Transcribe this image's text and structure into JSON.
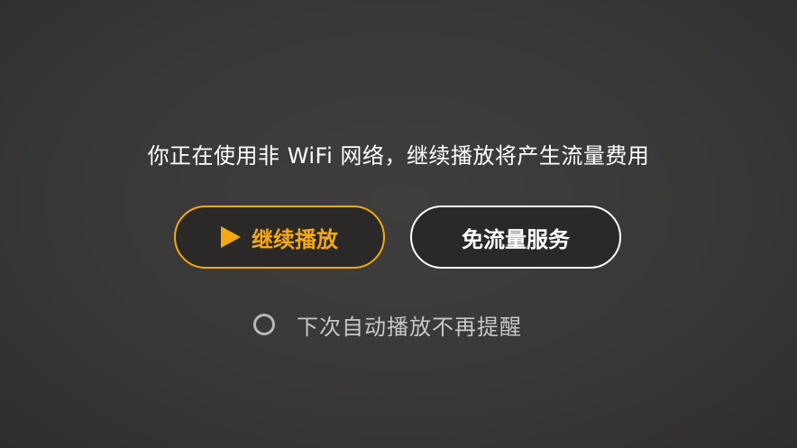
{
  "dialog": {
    "message": "你正在使用非 WiFi 网络，继续播放将产生流量费用",
    "continue_label": "继续播放",
    "free_data_label": "免流量服务",
    "no_remind_label": "下次自动播放不再提醒",
    "no_remind_checked": false
  },
  "colors": {
    "accent": "#f5a814",
    "background": "#393837",
    "text": "#ffffff",
    "secondary_text": "#c8c8c8"
  },
  "icons": {
    "continue_icon": "play-icon",
    "checkbox_icon": "radio-circle-icon"
  }
}
